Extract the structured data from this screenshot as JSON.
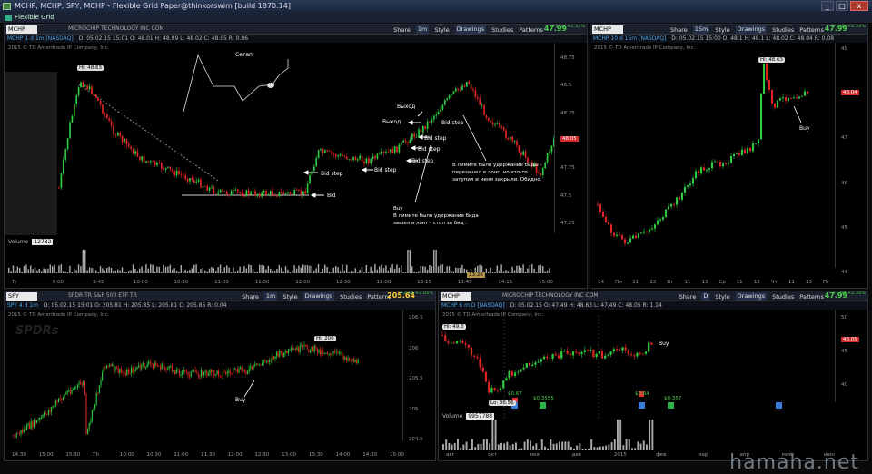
{
  "window": {
    "title": "MCHP, MCHP, SPY, MCHP - Flexible Grid Paper@thinkorswim [build 1870.14]",
    "grid_label": "Flexible Grid"
  },
  "toolbar": {
    "share": "Share",
    "style": "Style",
    "drawings": "Drawings",
    "studies": "Studies",
    "patterns": "Patterns",
    "interval_1m": "1m",
    "interval_15m": "15m",
    "interval_d": "D"
  },
  "panels": {
    "main": {
      "symbol": "MCHP",
      "company": "MICROCHIP TECHNOLOGY INC COM",
      "price": "47.99",
      "change": "+1.09 +2.33%",
      "desc": "MCHP 1 d 1m [NASDAQ]",
      "ohlc": "D: 05.02.15 15:01  O: 48.01  H: 48.09  L: 48.02  C: 48.05  R: 0.06",
      "tda": "2015 © TD Ameritrade IP Company, Inc.",
      "hi_label": "Hi: 48.63",
      "current_price": "48.05",
      "yticks": [
        "48.75",
        "48.5",
        "48.25",
        "48",
        "47.75",
        "47.5",
        "47.25"
      ],
      "xticks": [
        "Ty",
        "9:00",
        "9:45",
        "10:00",
        "10:30",
        "11:00",
        "11:30",
        "12:00",
        "12:30",
        "13:00",
        "13:15",
        "13:45",
        "14:15",
        "15:00"
      ],
      "time_badge": "13:26",
      "volume_label": "Volume",
      "volume_value": "12782",
      "notes": {
        "setup": "Сетап",
        "exit1": "Выход",
        "exit2": "Выход",
        "bid_step": "Bid step",
        "bid": "Bid",
        "right_note": "В лимите было удержание биды - перезашел в лонг. но что-то затупил и меня закрыли. Обидно.",
        "buy_note": "Buy\nВ лимите было удержание бида\nзашел в лонг - стоп за бид ."
      }
    },
    "top_right": {
      "symbol": "MCHP",
      "company": "",
      "price": "47.99",
      "change": "+1.08 +2.33%",
      "desc": "MCHP 10 d 15m [NASDAQ]",
      "ohlc": "D: 05.02.15 15:00  O: 48.1  H: 48.1  L: 48.02  C: 48.04  R: 0.08",
      "tda": "2015 © TD Ameritrade IP Company, Inc.",
      "hi_label": "Hi: 48.63",
      "current_price": "48.04",
      "buy": "Buy",
      "yticks": [
        "49",
        "48",
        "47",
        "46",
        "45",
        "44"
      ],
      "xticks": [
        "14",
        "Пн",
        "11",
        "13",
        "Вт",
        "11",
        "13",
        "Ср",
        "11",
        "13",
        "Чт",
        "11",
        "13",
        "Пт"
      ]
    },
    "bottom_left": {
      "symbol": "SPY",
      "company": "SPDR TR S&P 500 ETF TR",
      "price": "205.64",
      "change": "+2.13 +1.05%",
      "desc": "SPY 4 d 1m",
      "ohlc": "D: 05.02.15 15:01  O: 205.81  H: 205.85  L: 205.81  C: 205.85  R: 0.04",
      "tda": "2015 © TD Ameritrade IP Company, Inc.",
      "hi_label": "Hi: 206",
      "buy": "Buy",
      "logo": "SPDRs",
      "yticks": [
        "206.5",
        "206",
        "205.5",
        "205",
        "204.5"
      ],
      "xticks": [
        "14:30",
        "15:00",
        "15:30",
        "Th",
        "10:00",
        "10:30",
        "11:00",
        "11:30",
        "12:00",
        "12:30",
        "13:00",
        "13:30",
        "14:00",
        "14:30",
        "15:00"
      ]
    },
    "bottom_right": {
      "symbol": "MCHP",
      "company": "MICROCHIP TECHNOLOGY INC COM",
      "price": "47.99",
      "change": "+1.09 +2.33%",
      "desc": "MCHP 6 m D [NASDAQ]",
      "ohlc": "D: 05.02.15  O: 47.49  H: 48.63  L: 47.49  C: 48.05  R: 1.14",
      "tda": "2015 © TD Ameritrade IP Company, Inc.",
      "hi_label": "Hi: 49.6",
      "lo_label": "Lo: 36.56",
      "buy": "Buy",
      "current_price": "48.05",
      "div1": "$0.67",
      "div2": "$0.3555",
      "div3": "$0.64",
      "div4": "$0.357",
      "volume_label": "Volume",
      "volume_value": "9957788",
      "yticks": [
        "50",
        "45",
        "40"
      ],
      "xticks": [
        "авг",
        "окт",
        "ноя",
        "дек",
        "2015",
        "фев",
        "мар",
        "апр",
        "май",
        "июн"
      ]
    }
  },
  "watermark": "hamaha.net",
  "colors": {
    "up": "#2ecc40",
    "down": "#e02424",
    "price_bg": "#d62a2a",
    "accent": "#ffcf3a"
  }
}
